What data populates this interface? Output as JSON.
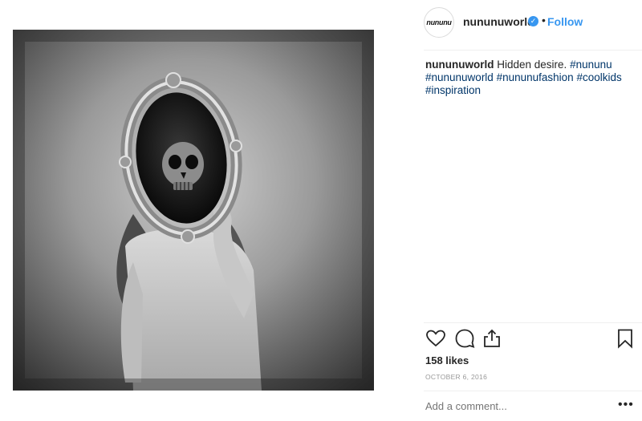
{
  "post": {
    "avatar_text": "nununu",
    "username": "nununuworld",
    "verified_icon": "verified-badge-icon",
    "separator": "•",
    "follow_label": "Follow"
  },
  "caption": {
    "user": "nununuworld",
    "text": "Hidden desire.",
    "tags": [
      "#nununu",
      "#nununuworld",
      "#nununufashion",
      "#coolkids",
      "#inspiration"
    ]
  },
  "actions": {
    "icons": [
      "heart-icon",
      "comment-icon",
      "share-icon",
      "bookmark-icon"
    ]
  },
  "likes": "158 likes",
  "date": "OCTOBER 6, 2016",
  "comment_input": {
    "placeholder": "Add a comment..."
  },
  "more_label": "•••",
  "colors": {
    "link_blue": "#3897f0",
    "hashtag": "#003569",
    "muted": "#999999",
    "text": "#262626"
  }
}
